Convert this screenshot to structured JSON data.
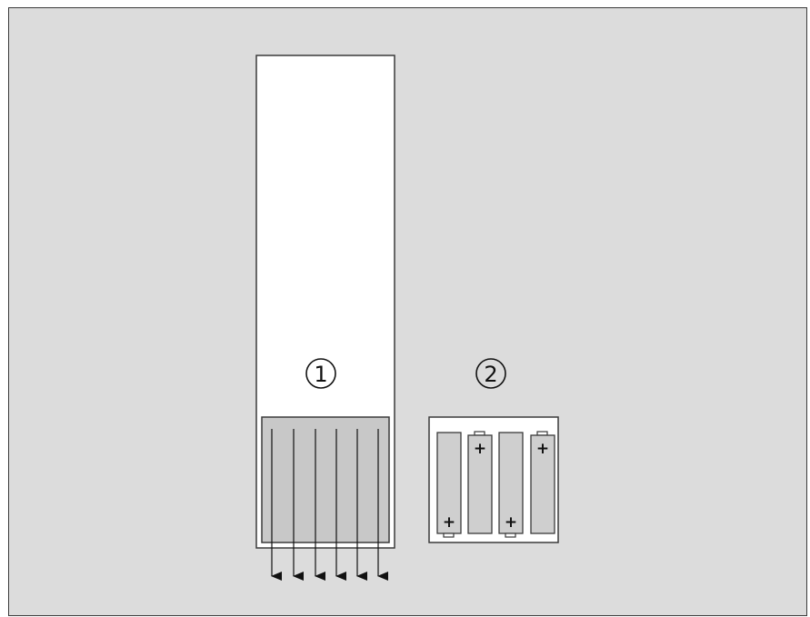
{
  "figure": {
    "background": "#dcdcdc",
    "stroke": "#3a3a3a",
    "device_fill": "#ffffff",
    "battery_fill": "#cfcfcf"
  },
  "callouts": {
    "one": {
      "label": "1"
    },
    "two": {
      "label": "2"
    }
  },
  "remote": {
    "insert_arrows": 6
  },
  "battery_pack": {
    "cells": [
      {
        "polarity_symbol": "+",
        "orientation": "plus-bottom"
      },
      {
        "polarity_symbol": "+",
        "orientation": "plus-top"
      },
      {
        "polarity_symbol": "+",
        "orientation": "plus-bottom"
      },
      {
        "polarity_symbol": "+",
        "orientation": "plus-top"
      }
    ]
  }
}
